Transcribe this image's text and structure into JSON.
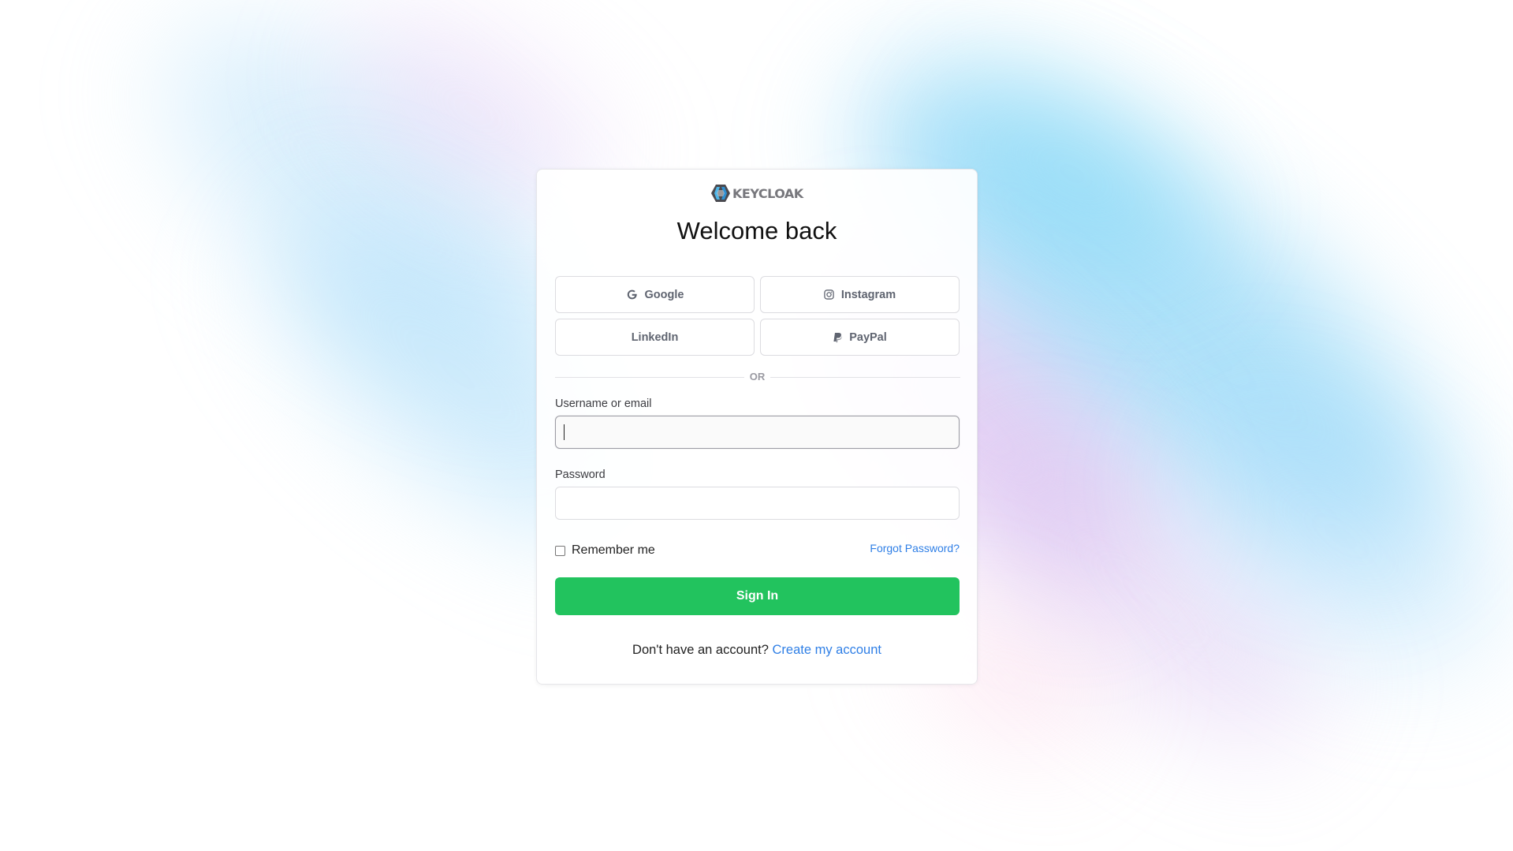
{
  "logo": {
    "text": "KEYCLOAK"
  },
  "title": "Welcome back",
  "providers": [
    {
      "label": "Google",
      "icon": "google-icon"
    },
    {
      "label": "Instagram",
      "icon": "instagram-icon"
    },
    {
      "label": "LinkedIn",
      "icon": ""
    },
    {
      "label": "PayPal",
      "icon": "paypal-icon"
    }
  ],
  "divider": {
    "text": "OR"
  },
  "form": {
    "username_label": "Username or email",
    "username_value": "",
    "password_label": "Password",
    "password_value": "",
    "remember_label": "Remember me",
    "remember_checked": false,
    "forgot_label": "Forgot Password?",
    "submit_label": "Sign In"
  },
  "register": {
    "prompt": "Don't have an account?",
    "link_label": "Create my account"
  },
  "colors": {
    "primary": "#22c35e",
    "link": "#2f7fe6",
    "text": "#111111"
  }
}
